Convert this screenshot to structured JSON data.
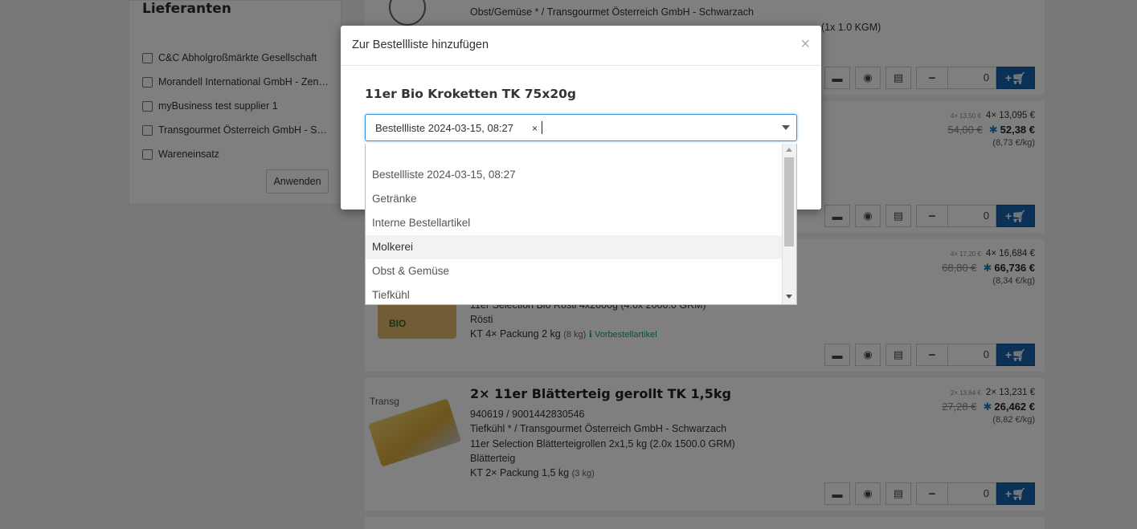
{
  "sidebar": {
    "title": "Lieferanten",
    "filters": [
      {
        "label": "C&C Abholgroßmärkte Gesellschaft"
      },
      {
        "label": "Morandell International GmbH - Zentrale"
      },
      {
        "label": "myBusiness test supplier 1"
      },
      {
        "label": "Transgourmet Österreich GmbH - Schwarzach"
      },
      {
        "label": "Wareneinsatz"
      }
    ],
    "apply_label": "Anwenden"
  },
  "products": [
    {
      "line_category": "Obst/Gemüse * / Transgourmet Österreich GmbH - Schwarzach",
      "line_extra": "(1x 1.0 KGM)",
      "qty": "0"
    },
    {
      "price_tiny": "4× 13,50 €",
      "price_unit_each": "4× 13,095 €",
      "price_old": "54,00 €",
      "price_new": "52,38 €",
      "price_per_kg": "(8,73 €/kg)",
      "qty": "0"
    },
    {
      "price_tiny": "4× 17,20 €",
      "price_unit_each": "4× 16,684 €",
      "price_old": "68,80 €",
      "price_new": "66,736 €",
      "price_per_kg": "(8,34 €/kg)",
      "line_desc": "11er Selection Bio Rösti 4x2000g (4.0x 2000.0 GRM)",
      "line_short": "Rösti",
      "line_pack": "KT 4× Packung 2 kg",
      "line_pack_small": "(8 kg)",
      "line_preorder": "ℹ Vorbestellartikel",
      "qty": "0"
    },
    {
      "img_alt": "Transg",
      "title": "2× 11er Blätterteig gerollt TK 1,5kg",
      "line_ids": "940619 / 9001442830546",
      "line_category": "Tiefkühl * / Transgourmet Österreich GmbH - Schwarzach",
      "line_desc": "11er Selection Blätterteigrollen 2x1,5 kg (2.0x 1500.0 GRM)",
      "line_short": "Blätterteig",
      "line_pack": "KT 2× Packung 1,5 kg",
      "line_pack_small": "(3 kg)",
      "price_tiny": "2× 13,64 €",
      "price_unit_each": "2× 13,231 €",
      "price_old": "27,28 €",
      "price_new": "26,462 €",
      "price_per_kg": "(8,82 €/kg)",
      "qty": "0"
    }
  ],
  "modal": {
    "title": "Zur Bestellliste hinzufügen",
    "close_label": "×",
    "product_name": "11er Bio Kroketten TK 75x20g",
    "select_value": "Bestellliste 2024-03-15, 08:27",
    "select_clear": "×",
    "options": [
      {
        "label": "Bestellliste 2024-03-15, 08:27"
      },
      {
        "label": "Getränke"
      },
      {
        "label": "Interne Bestellartikel"
      },
      {
        "label": "Molkerei"
      },
      {
        "label": "Obst & Gemüse"
      },
      {
        "label": "Tiefkühl"
      }
    ]
  },
  "colors": {
    "accent": "#1665ad",
    "focus_border": "#3b8fd4",
    "star": "#1b7fc2",
    "link": "#1a9a8f"
  }
}
